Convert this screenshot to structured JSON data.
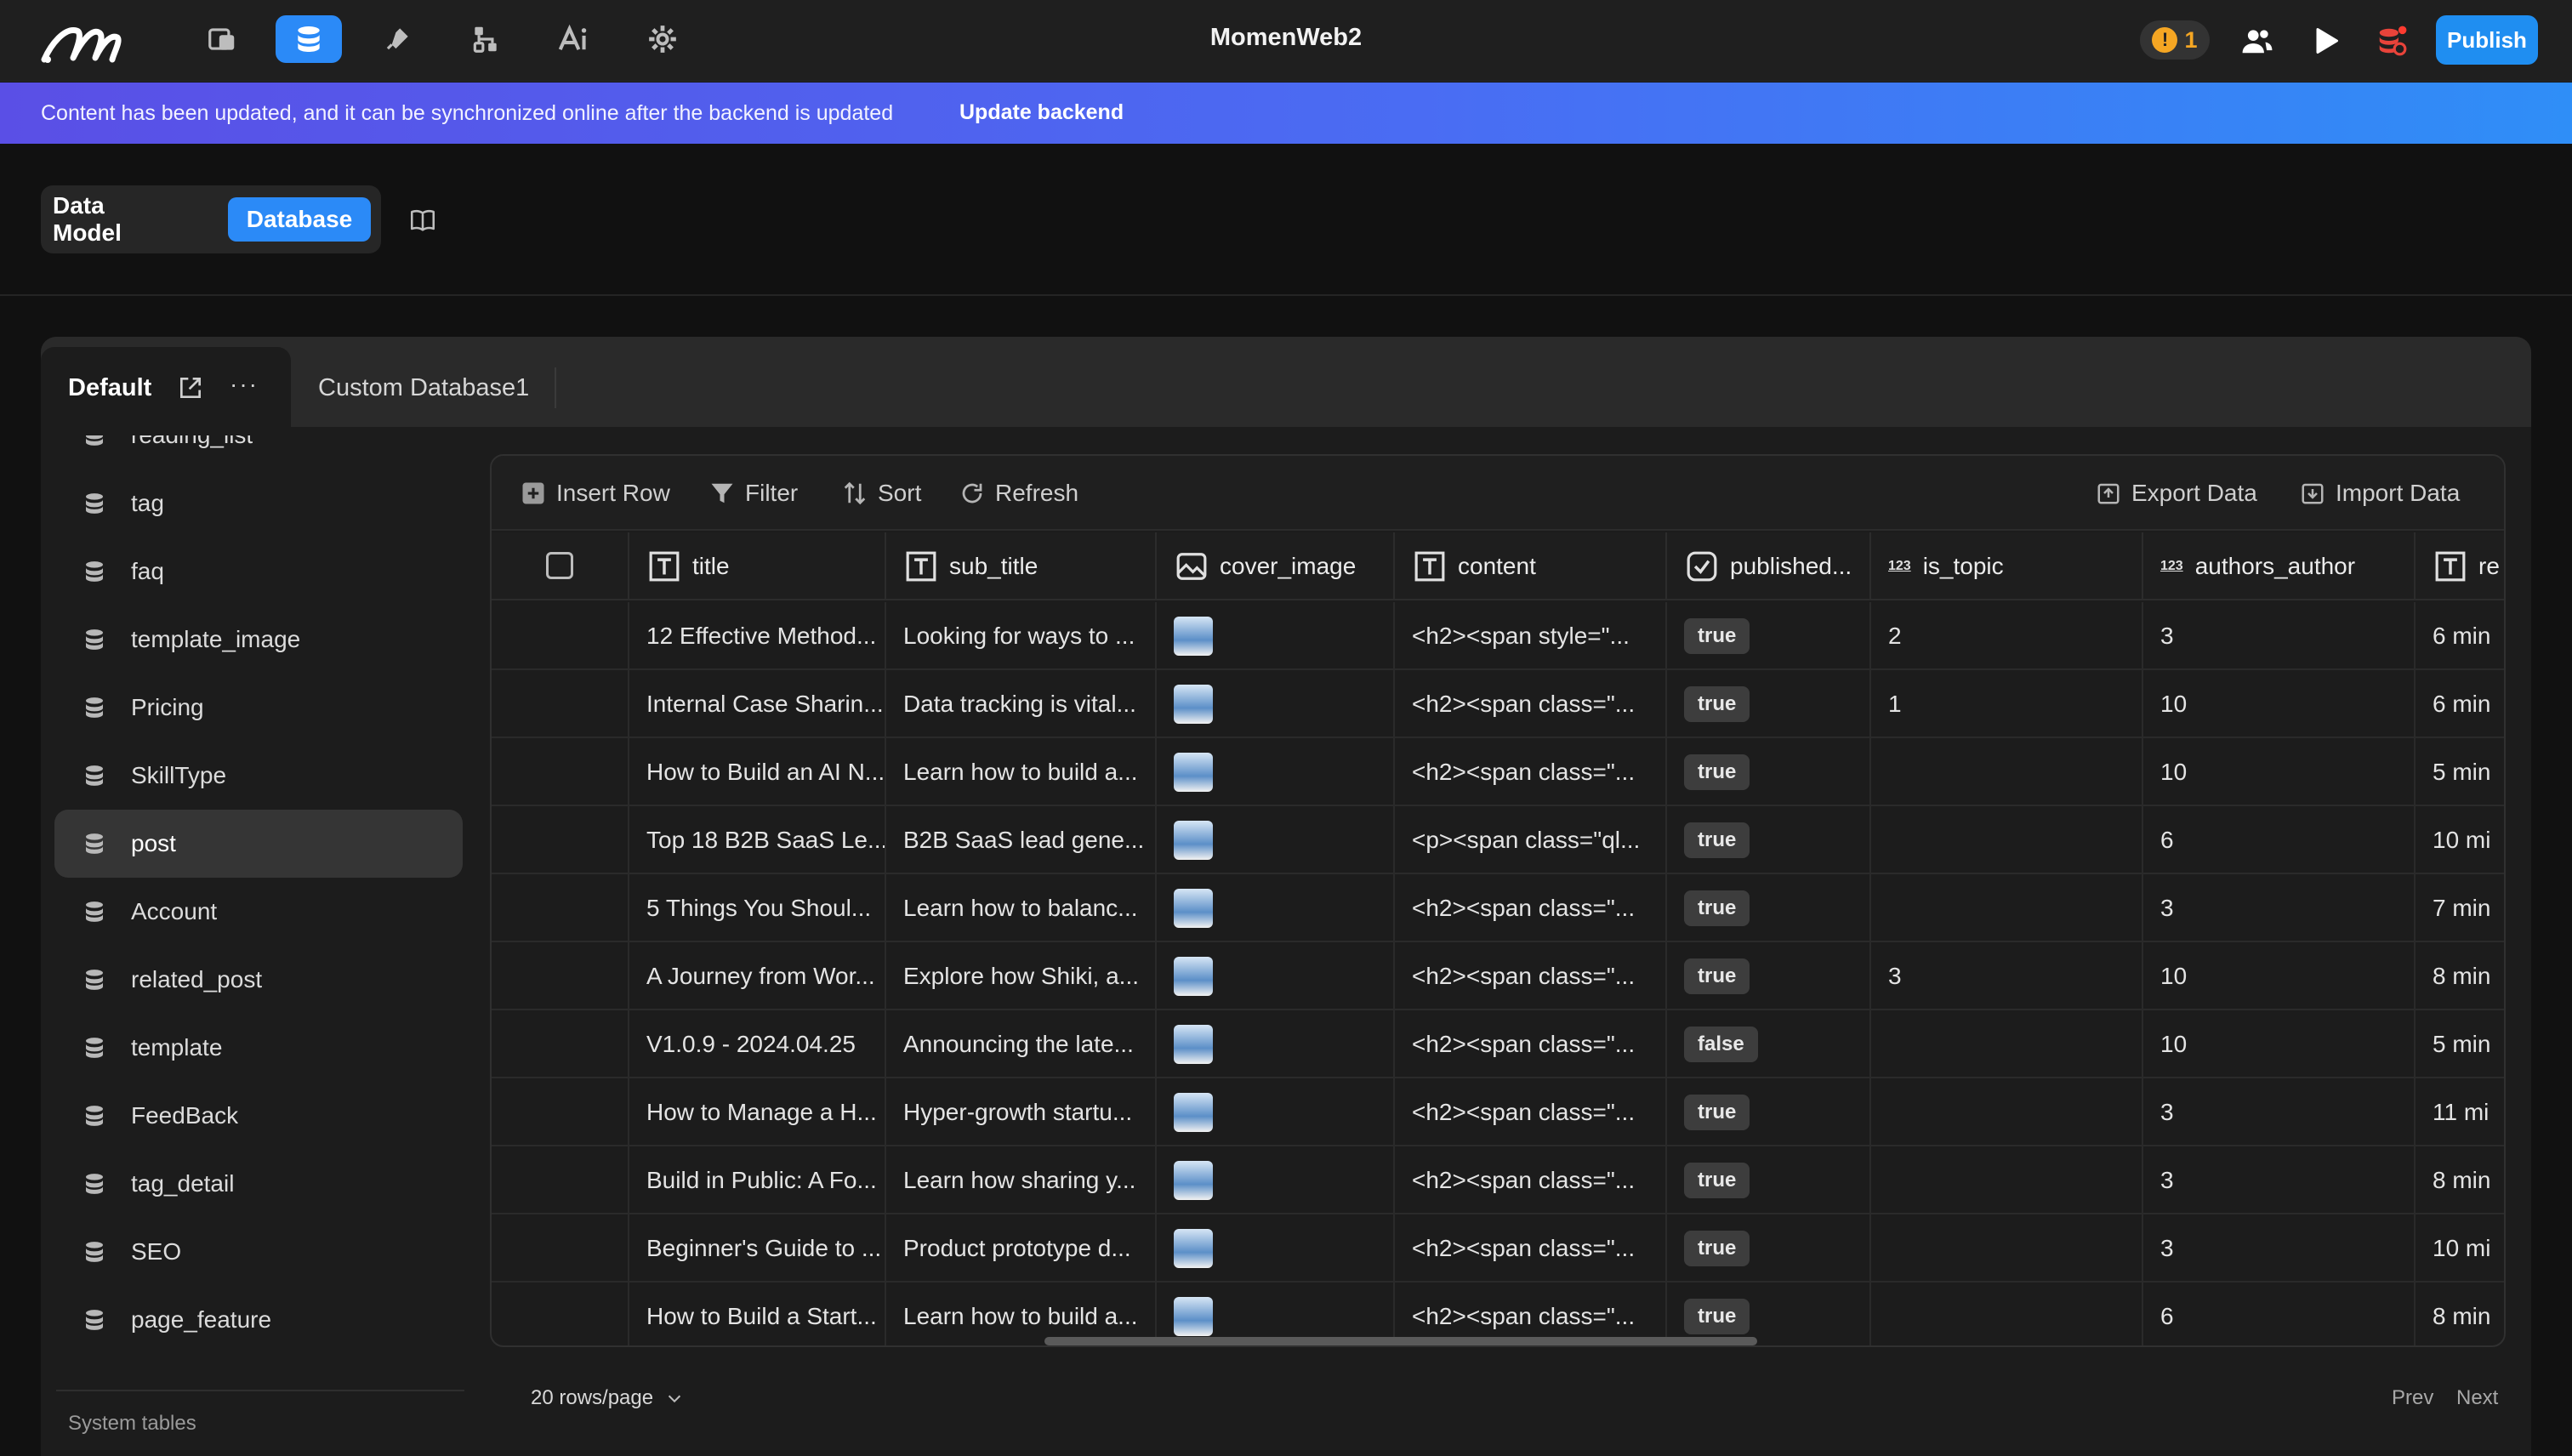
{
  "app": {
    "title": "MomenWeb2",
    "warning_count": "1",
    "publish_label": "Publish"
  },
  "nav": {
    "items": [
      "pages-icon",
      "database-icon",
      "plugin-icon",
      "workflow-icon",
      "ai-icon",
      "settings-icon"
    ],
    "active": "database-icon"
  },
  "banner": {
    "text": "Content has been updated, and it can be synchronized online after the backend is updated",
    "action": "Update backend"
  },
  "mode": {
    "data_model": "Data Model",
    "database": "Database"
  },
  "tabs": {
    "default": "Default",
    "more": "···",
    "custom": "Custom Database1"
  },
  "sidebar": {
    "items": [
      {
        "label": "reading_list"
      },
      {
        "label": "tag"
      },
      {
        "label": "faq"
      },
      {
        "label": "template_image"
      },
      {
        "label": "Pricing"
      },
      {
        "label": "SkillType"
      },
      {
        "label": "post",
        "active": true
      },
      {
        "label": "Account"
      },
      {
        "label": "related_post"
      },
      {
        "label": "template"
      },
      {
        "label": "FeedBack"
      },
      {
        "label": "tag_detail"
      },
      {
        "label": "SEO"
      },
      {
        "label": "page_feature"
      }
    ],
    "system_tables": "System tables"
  },
  "toolbar": {
    "insert_row": "Insert Row",
    "filter": "Filter",
    "sort": "Sort",
    "refresh": "Refresh",
    "export": "Export Data",
    "import": "Import Data"
  },
  "columns": {
    "title": "title",
    "sub_title": "sub_title",
    "cover_image": "cover_image",
    "content": "content",
    "published": "published...",
    "is_topic": "is_topic",
    "authors_author": "authors_author",
    "reading": "re",
    "number_type_glyph": "123"
  },
  "rows": [
    {
      "title": "12 Effective Method...",
      "sub_title": "Looking for ways to ...",
      "content": "<h2><span style=\"...",
      "published": "true",
      "is_topic": "2",
      "authors_author": "3",
      "reading": "6 min"
    },
    {
      "title": "Internal Case Sharin...",
      "sub_title": "Data tracking is vital...",
      "content": "<h2><span class=\"...",
      "published": "true",
      "is_topic": "1",
      "authors_author": "10",
      "reading": "6 min"
    },
    {
      "title": "How to Build an AI N...",
      "sub_title": "Learn how to build a...",
      "content": "<h2><span class=\"...",
      "published": "true",
      "is_topic": "",
      "authors_author": "10",
      "reading": "5 min"
    },
    {
      "title": "Top 18 B2B SaaS Le...",
      "sub_title": "B2B SaaS lead gene...",
      "content": "<p><span class=\"ql...",
      "published": "true",
      "is_topic": "",
      "authors_author": "6",
      "reading": "10 mi"
    },
    {
      "title": "5 Things You Shoul...",
      "sub_title": "Learn how to balanc...",
      "content": "<h2><span class=\"...",
      "published": "true",
      "is_topic": "",
      "authors_author": "3",
      "reading": "7 min"
    },
    {
      "title": "A Journey from Wor...",
      "sub_title": "Explore how Shiki, a...",
      "content": "<h2><span class=\"...",
      "published": "true",
      "is_topic": "3",
      "authors_author": "10",
      "reading": "8 min"
    },
    {
      "title": "V1.0.9 - 2024.04.25",
      "sub_title": "Announcing the late...",
      "content": "<h2><span class=\"...",
      "published": "false",
      "is_topic": "",
      "authors_author": "10",
      "reading": "5 min"
    },
    {
      "title": "How to Manage a H...",
      "sub_title": "Hyper-growth startu...",
      "content": "<h2><span class=\"...",
      "published": "true",
      "is_topic": "",
      "authors_author": "3",
      "reading": "11 mi"
    },
    {
      "title": "Build in Public: A Fo...",
      "sub_title": "Learn how sharing y...",
      "content": "<h2><span class=\"...",
      "published": "true",
      "is_topic": "",
      "authors_author": "3",
      "reading": "8 min"
    },
    {
      "title": "Beginner's Guide to ...",
      "sub_title": "Product prototype d...",
      "content": "<h2><span class=\"...",
      "published": "true",
      "is_topic": "",
      "authors_author": "3",
      "reading": "10 mi"
    },
    {
      "title": "How to Build a Start...",
      "sub_title": "Learn how to build a...",
      "content": "<h2><span class=\"...",
      "published": "true",
      "is_topic": "",
      "authors_author": "6",
      "reading": "8 min"
    }
  ],
  "pagination": {
    "rows_per_page": "20 rows/page",
    "prev": "Prev",
    "next": "Next"
  },
  "colors": {
    "accent": "#2b8af7",
    "warning": "#f5a623",
    "bg": "#111111"
  }
}
